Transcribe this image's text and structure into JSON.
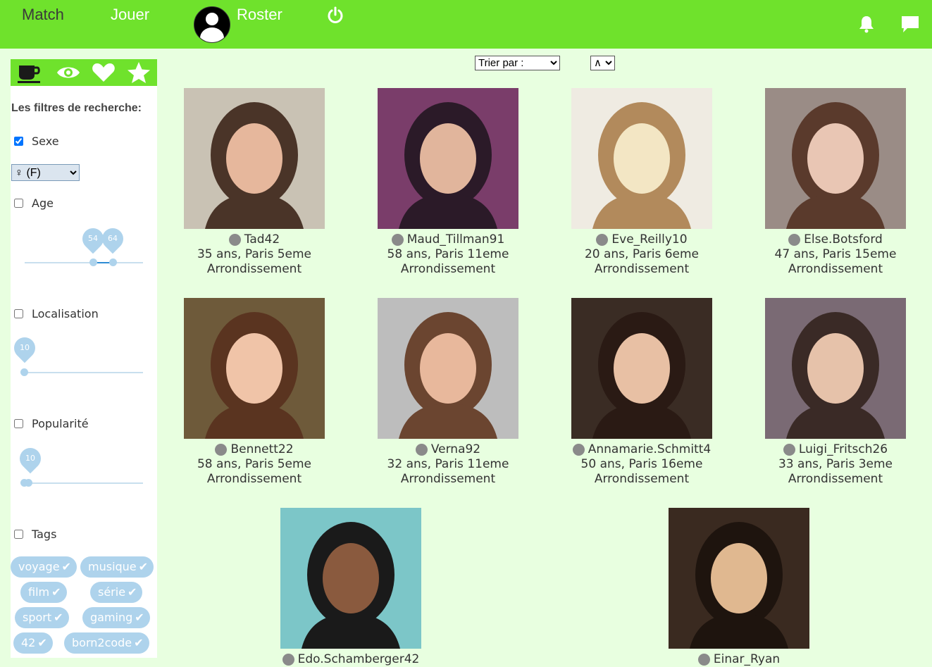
{
  "nav": {
    "match": "Match",
    "jouer": "Jouer",
    "roster": "Roster"
  },
  "sidebar": {
    "tabs": [
      "coffee-icon",
      "eye-icon",
      "heart-icon",
      "star-icon"
    ],
    "filters_title": "Les filtres de recherche:",
    "sexe_label": "Sexe",
    "sexe_checked": true,
    "sexe_value": "♀ (F)",
    "age_label": "Age",
    "age_min": "54",
    "age_max": "64",
    "localisation_label": "Localisation",
    "localisation_value": "10",
    "popularite_label": "Popularité",
    "popularite_value": "10",
    "tags_label": "Tags",
    "tags": [
      "voyage",
      "musique",
      "film",
      "série",
      "sport",
      "gaming",
      "42",
      "born2code"
    ]
  },
  "sort": {
    "trier_par": "Trier par :",
    "direction": "∧"
  },
  "profiles": [
    {
      "name": "Tad42",
      "line1": "35 ans, Paris 5eme",
      "line2": "Arrondissement",
      "bg": "#c9c2b4",
      "fg": "#4a3428",
      "skin": "#e6b79c"
    },
    {
      "name": "Maud_Tillman91",
      "line1": "58 ans, Paris 11eme",
      "line2": "Arrondissement",
      "bg": "#7a3d6a",
      "fg": "#2b1a28",
      "skin": "#e1b59c"
    },
    {
      "name": "Eve_Reilly10",
      "line1": "20 ans, Paris 6eme",
      "line2": "Arrondissement",
      "bg": "#efebe2",
      "fg": "#b28a5c",
      "skin": "#f3e6c4"
    },
    {
      "name": "Else.Botsford",
      "line1": "47 ans, Paris 15eme",
      "line2": "Arrondissement",
      "bg": "#9a8c86",
      "fg": "#5a3a2c",
      "skin": "#e9c6b4"
    },
    {
      "name": "Bennett22",
      "line1": "58 ans, Paris 5eme",
      "line2": "Arrondissement",
      "bg": "#6e5a3a",
      "fg": "#5a3420",
      "skin": "#f0c4a8"
    },
    {
      "name": "Verna92",
      "line1": "32 ans, Paris 11eme",
      "line2": "Arrondissement",
      "bg": "#bdbdbd",
      "fg": "#6b4530",
      "skin": "#e8b89c"
    },
    {
      "name": "Annamarie.Schmitt4",
      "line1": "50 ans, Paris 16eme",
      "line2": "Arrondissement",
      "bg": "#3a2c24",
      "fg": "#2a1a14",
      "skin": "#e8c0a4"
    },
    {
      "name": "Luigi_Fritsch26",
      "line1": "33 ans, Paris 3eme",
      "line2": "Arrondissement",
      "bg": "#7a6a74",
      "fg": "#3a2a26",
      "skin": "#e6c2aa"
    },
    {
      "name": "Edo.Schamberger42",
      "line1": "",
      "line2": "",
      "bg": "#7cc6c8",
      "fg": "#1a1a1a",
      "skin": "#8a5a3e"
    },
    {
      "name": "Einar_Ryan",
      "line1": "",
      "line2": "",
      "bg": "#3a2a20",
      "fg": "#1e140e",
      "skin": "#e0b890"
    }
  ]
}
